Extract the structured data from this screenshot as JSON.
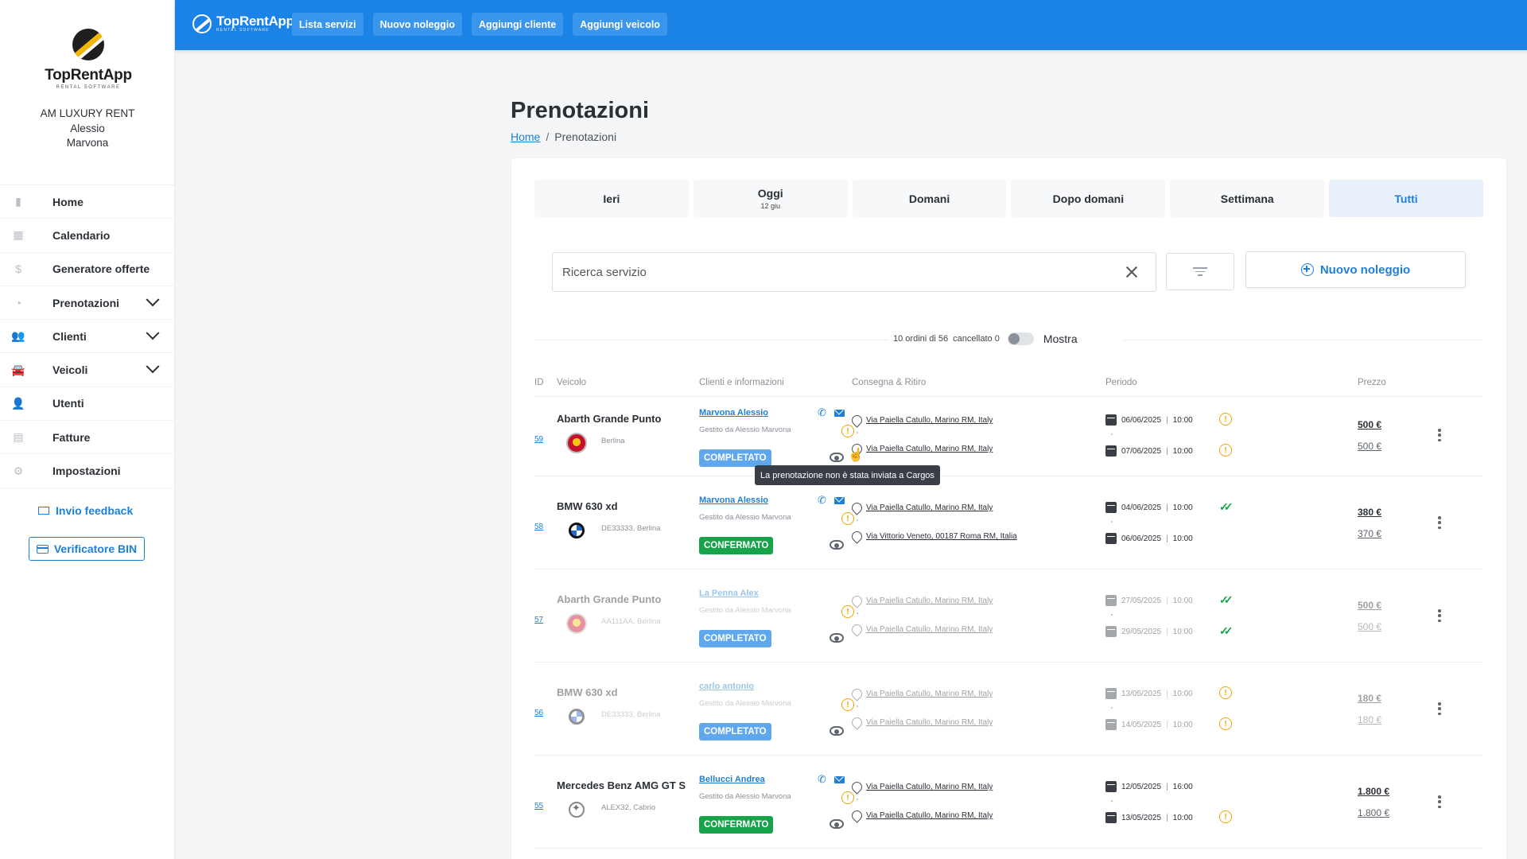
{
  "sidebar": {
    "logo_text": "TopRentApp",
    "logo_sub": "RENTAL SOFTWARE",
    "company_name": "AM LUXURY RENT",
    "user_first": "Alessio",
    "user_last": "Marvona",
    "items": [
      {
        "label": "Home",
        "icon": "chart-icon"
      },
      {
        "label": "Calendario",
        "icon": "calendar-icon"
      },
      {
        "label": "Generatore offerte",
        "icon": "money-icon"
      },
      {
        "label": "Prenotazioni",
        "icon": "clock-icon",
        "expandable": true
      },
      {
        "label": "Clienti",
        "icon": "users-icon",
        "expandable": true
      },
      {
        "label": "Veicoli",
        "icon": "car-icon",
        "expandable": true
      },
      {
        "label": "Utenti",
        "icon": "user-icon"
      },
      {
        "label": "Fatture",
        "icon": "document-icon"
      },
      {
        "label": "Impostazioni",
        "icon": "gear-icon"
      }
    ],
    "feedback_label": "Invio feedback",
    "bin_label": "Verificatore BIN"
  },
  "topbar": {
    "logo_text": "TopRentApp",
    "logo_sub": "RENTAL SOFTWARE",
    "buttons": [
      "Lista servizi",
      "Nuovo noleggio",
      "Aggiungi cliente",
      "Aggiungi veicolo"
    ]
  },
  "page": {
    "title": "Prenotazioni",
    "breadcrumb_home": "Home",
    "breadcrumb_sep": "/",
    "breadcrumb_current": "Prenotazioni"
  },
  "tabs": [
    {
      "label": "Ieri"
    },
    {
      "label": "Oggi",
      "sub": "12 giu"
    },
    {
      "label": "Domani"
    },
    {
      "label": "Dopo domani"
    },
    {
      "label": "Settimana"
    },
    {
      "label": "Tutti",
      "active": true
    }
  ],
  "search": {
    "placeholder": "Ricerca servizio"
  },
  "new_booking_label": "Nuovo noleggio",
  "counter": {
    "orders": "10 ordini di 56",
    "cancelled": "cancellato 0",
    "toggle_label": "Mostra"
  },
  "table": {
    "headers": [
      "ID",
      "Veicolo",
      "Clienti e informazioni",
      "Consegna & Ritiro",
      "Periodo",
      "Prezzo"
    ],
    "rows": [
      {
        "id": "59",
        "vehicle": "Abarth Grande Punto",
        "vehicle_sub": "Berlina",
        "logo": "abarth",
        "client": "Marvona Alessio",
        "managed": "Gestito da Alessio Marvona",
        "status": "COMPLETATO",
        "status_type": "completed",
        "addr1": "Via Paiella Catullo, Marino RM, Italy",
        "addr2": "Via Paiella Catullo, Marino RM, Italy",
        "date1": "06/06/2025",
        "time1": "10:00",
        "date2": "07/06/2025",
        "time2": "10:00",
        "state1": "warn",
        "state2": "warn",
        "price1": "500 €",
        "price2": "500 €",
        "dim": false
      },
      {
        "id": "58",
        "vehicle": "BMW 630 xd",
        "vehicle_sub": "DE33333, Berlina",
        "logo": "bmw",
        "client": "Marvona Alessio",
        "managed": "Gestito da Alessio Marvona",
        "status": "CONFERMATO",
        "status_type": "confirmed",
        "addr1": "Via Paiella Catullo, Marino RM, Italy",
        "addr2": "Via Vittorio Veneto, 00187 Roma RM, Italia",
        "date1": "04/06/2025",
        "time1": "10:00",
        "date2": "06/06/2025",
        "time2": "10:00",
        "state1": "check",
        "state2": "",
        "price1": "380 €",
        "price2": "370 €",
        "dim": false
      },
      {
        "id": "57",
        "vehicle": "Abarth Grande Punto",
        "vehicle_sub": "AA111AA, Berlina",
        "logo": "abarth",
        "client": "La Penna Alex",
        "managed": "Gestito da Alessio Marvona",
        "status": "COMPLETATO",
        "status_type": "completed",
        "addr1": "Via Paiella Catullo, Marino RM, Italy",
        "addr2": "Via Paiella Catullo, Marino RM, Italy",
        "date1": "27/05/2025",
        "time1": "10:00",
        "date2": "29/05/2025",
        "time2": "10:00",
        "state1": "check",
        "state2": "check",
        "price1": "500 €",
        "price2": "500 €",
        "dim": true
      },
      {
        "id": "56",
        "vehicle": "BMW 630 xd",
        "vehicle_sub": "DE33333, Berlina",
        "logo": "bmw",
        "client": "carlo antonio",
        "managed": "Gestito da Alessio Marvona",
        "status": "COMPLETATO",
        "status_type": "completed",
        "addr1": "Via Paiella Catullo, Marino RM, Italy",
        "addr2": "Via Paiella Catullo, Marino RM, Italy",
        "date1": "13/05/2025",
        "time1": "10:00",
        "date2": "14/05/2025",
        "time2": "10:00",
        "state1": "warn",
        "state2": "warn",
        "price1": "180 €",
        "price2": "180 €",
        "dim": true
      },
      {
        "id": "55",
        "vehicle": "Mercedes Benz AMG GT S",
        "vehicle_sub": "ALEX32, Cabrio",
        "logo": "merc",
        "client": "Bellucci Andrea",
        "managed": "Gestito da Alessio Marvona",
        "status": "CONFERMATO",
        "status_type": "confirmed",
        "addr1": "Via Paiella Catullo, Marino RM, Italy",
        "addr2": "Via Paiella Catullo, Marino RM, Italy",
        "date1": "12/05/2025",
        "time1": "16:00",
        "date2": "13/05/2025",
        "time2": "10:00",
        "state1": "",
        "state2": "warn",
        "price1": "1.800 €",
        "price2": "1.800 €",
        "dim": false
      }
    ]
  },
  "tooltip": "La prenotazione non è stata inviata a Cargos",
  "colors": {
    "primary": "#1b82e6",
    "confirmed": "#16a34a",
    "completed": "#5fa8ee",
    "warning": "#f0a500"
  }
}
